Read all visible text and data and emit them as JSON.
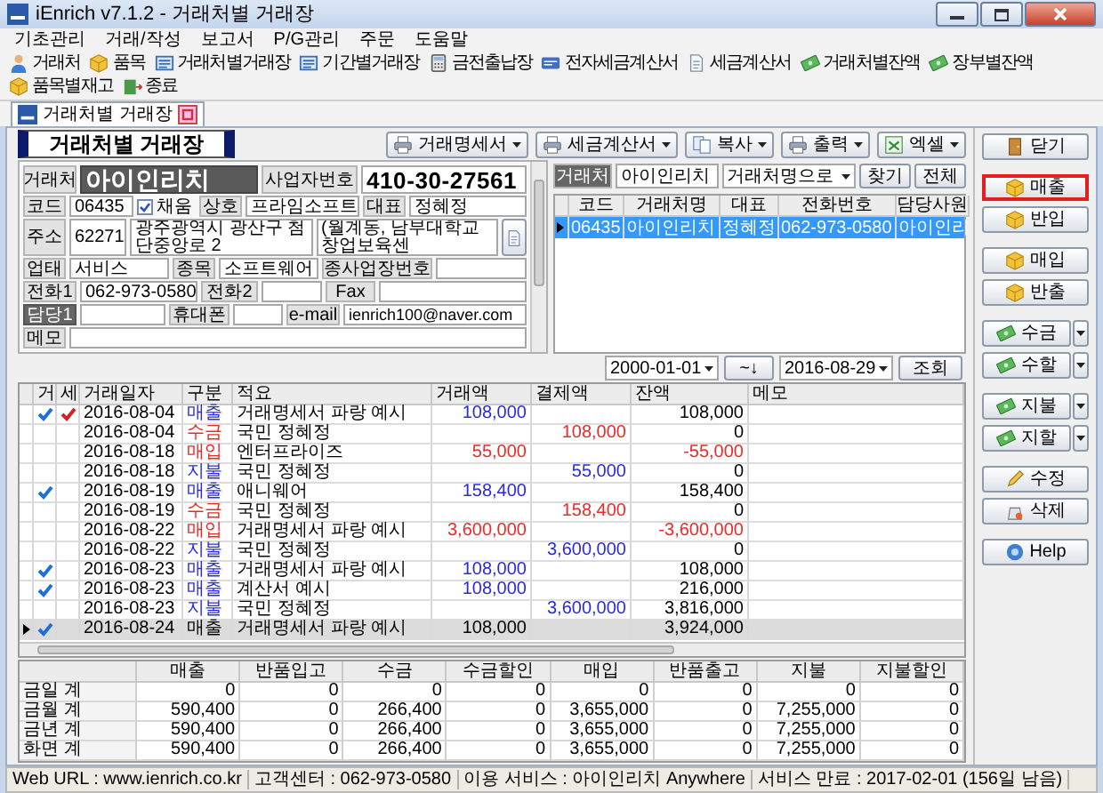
{
  "window": {
    "title": "iEnrich v7.1.2 - 거래처별 거래장"
  },
  "menu": [
    "기초관리",
    "거래/작성",
    "보고서",
    "P/G관리",
    "주문",
    "도움말"
  ],
  "toolbar": [
    "거래처",
    "품목",
    "거래처별거래장",
    "기간별거래장",
    "금전출납장",
    "전자세금계산서",
    "세금계산서",
    "거래처별잔액",
    "장부별잔액",
    "품목별재고",
    "종료"
  ],
  "tabs": [
    {
      "label": "거래처별 거래장",
      "selected": true
    }
  ],
  "page_title": "거래처별 거래장",
  "action_buttons": [
    "거래명세서",
    "세금계산서",
    "복사",
    "출력",
    "엑셀"
  ],
  "customer_form": {
    "rows": [
      [
        {
          "kind": "label",
          "text": "거래처"
        },
        {
          "kind": "name",
          "text": "아이인리치"
        },
        {
          "kind": "label",
          "text": "사업자번호"
        },
        {
          "kind": "big",
          "text": "410-30-27561"
        }
      ],
      [
        {
          "kind": "label",
          "text": "코드"
        },
        {
          "kind": "value",
          "text": "06435"
        },
        {
          "kind": "check",
          "text": "채움",
          "checked": true
        },
        {
          "kind": "label",
          "text": "상호"
        },
        {
          "kind": "value",
          "text": "프라임소프트"
        },
        {
          "kind": "label",
          "text": "대표"
        },
        {
          "kind": "value",
          "text": "정혜정"
        }
      ],
      [
        {
          "kind": "label",
          "text": "주소"
        },
        {
          "kind": "value",
          "text": "62271"
        },
        {
          "kind": "value",
          "text": "광주광역시 광산구 첨단중앙로 2"
        },
        {
          "kind": "value",
          "text": "(월계동, 남부대학교창업보육센"
        },
        {
          "kind": "lookup"
        }
      ],
      [
        {
          "kind": "label",
          "text": "업태"
        },
        {
          "kind": "value",
          "text": "서비스"
        },
        {
          "kind": "label",
          "text": "종목"
        },
        {
          "kind": "value",
          "text": "소프트웨어"
        },
        {
          "kind": "label",
          "text": "종사업장번호"
        },
        {
          "kind": "value"
        }
      ],
      [
        {
          "kind": "label",
          "text": "전화1"
        },
        {
          "kind": "value",
          "text": "062-973-0580"
        },
        {
          "kind": "label",
          "text": "전화2"
        },
        {
          "kind": "value"
        },
        {
          "kind": "label",
          "text": "Fax"
        },
        {
          "kind": "value"
        }
      ],
      [
        {
          "kind": "label_dark",
          "text": "담당1"
        },
        {
          "kind": "value"
        },
        {
          "kind": "label",
          "text": "휴대폰"
        },
        {
          "kind": "value"
        },
        {
          "kind": "label",
          "text": "e-mail"
        },
        {
          "kind": "value",
          "text": "ienrich100@naver.com"
        }
      ],
      [
        {
          "kind": "label",
          "text": "메모"
        },
        {
          "kind": "value"
        }
      ]
    ]
  },
  "customer_list": {
    "search_label": "거래처",
    "search_value": "아이인리치",
    "search_mode": "거래처명으로",
    "buttons": [
      "찾기",
      "전체"
    ],
    "columns": [
      "코드",
      "거래처명",
      "대표",
      "전화번호",
      "담당사원"
    ],
    "rows": [
      {
        "cells": [
          "06435",
          "아이인리치",
          "정혜정",
          "062-973-0580",
          "아이인리"
        ],
        "selected": true
      }
    ]
  },
  "date_filter": {
    "from": "2000-01-01",
    "range_button": "~↓",
    "to": "2016-08-29",
    "search_button": "조회"
  },
  "transactions": {
    "columns": [
      "거",
      "세",
      "거래일자",
      "구분",
      "적요",
      "거래액",
      "결제액",
      "잔액",
      "메모"
    ],
    "rows": [
      {
        "trade_checked": true,
        "tax_checked": true,
        "date": "2016-08-04",
        "kind": "sale",
        "type_label": "매출",
        "description": "거래명세서 파랑 예시",
        "amount": "108,000",
        "balance": "108,000",
        "balance_negative": false,
        "selected": false
      },
      {
        "trade_checked": false,
        "tax_checked": false,
        "date": "2016-08-04",
        "kind": "receipt",
        "type_label": "수금",
        "description": "국민 정혜정",
        "paid": "108,000",
        "balance": "0",
        "balance_negative": false,
        "selected": false
      },
      {
        "trade_checked": false,
        "tax_checked": false,
        "date": "2016-08-18",
        "kind": "purchase",
        "type_label": "매입",
        "description": "엔터프라이즈",
        "amount": "55,000",
        "balance": "-55,000",
        "balance_negative": true,
        "selected": false
      },
      {
        "trade_checked": false,
        "tax_checked": false,
        "date": "2016-08-18",
        "kind": "payment",
        "type_label": "지불",
        "description": "국민 정혜정",
        "paid": "55,000",
        "balance": "0",
        "balance_negative": false,
        "selected": false
      },
      {
        "trade_checked": true,
        "tax_checked": false,
        "date": "2016-08-19",
        "kind": "sale",
        "type_label": "매출",
        "description": "애니웨어",
        "amount": "158,400",
        "balance": "158,400",
        "balance_negative": false,
        "selected": false
      },
      {
        "trade_checked": false,
        "tax_checked": false,
        "date": "2016-08-19",
        "kind": "receipt",
        "type_label": "수금",
        "description": "국민 정혜정",
        "paid": "158,400",
        "balance": "0",
        "balance_negative": false,
        "selected": false
      },
      {
        "trade_checked": false,
        "tax_checked": false,
        "date": "2016-08-22",
        "kind": "purchase",
        "type_label": "매입",
        "description": "거래명세서 파랑 예시",
        "amount": "3,600,000",
        "balance": "-3,600,000",
        "balance_negative": true,
        "selected": false
      },
      {
        "trade_checked": false,
        "tax_checked": false,
        "date": "2016-08-22",
        "kind": "payment",
        "type_label": "지불",
        "description": "국민 정혜정",
        "paid": "3,600,000",
        "balance": "0",
        "balance_negative": false,
        "selected": false
      },
      {
        "trade_checked": true,
        "tax_checked": false,
        "date": "2016-08-23",
        "kind": "sale",
        "type_label": "매출",
        "description": "거래명세서 파랑 예시",
        "amount": "108,000",
        "balance": "108,000",
        "balance_negative": false,
        "selected": false
      },
      {
        "trade_checked": true,
        "tax_checked": false,
        "date": "2016-08-23",
        "kind": "sale",
        "type_label": "매출",
        "description": "계산서 예시",
        "amount": "108,000",
        "balance": "216,000",
        "balance_negative": false,
        "selected": false
      },
      {
        "trade_checked": false,
        "tax_checked": false,
        "date": "2016-08-23",
        "kind": "payment",
        "type_label": "지불",
        "description": "국민 정혜정",
        "paid": "3,600,000",
        "balance": "3,816,000",
        "balance_negative": false,
        "selected": false
      },
      {
        "trade_checked": true,
        "tax_checked": false,
        "date": "2016-08-24",
        "kind": "sale",
        "type_label": "매출",
        "description": "거래명세서 파랑 예시",
        "amount": "108,000",
        "balance": "3,924,000",
        "balance_negative": false,
        "selected": true
      }
    ]
  },
  "summary": {
    "columns": [
      "매출",
      "반품입고",
      "수금",
      "수금할인",
      "매입",
      "반품출고",
      "지불",
      "지불할인"
    ],
    "rows": [
      {
        "label": "금일 계",
        "values": [
          "0",
          "0",
          "0",
          "0",
          "0",
          "0",
          "0",
          "0"
        ]
      },
      {
        "label": "금월 계",
        "values": [
          "590,400",
          "0",
          "266,400",
          "0",
          "3,655,000",
          "0",
          "7,255,000",
          "0"
        ]
      },
      {
        "label": "금년 계",
        "values": [
          "590,400",
          "0",
          "266,400",
          "0",
          "3,655,000",
          "0",
          "7,255,000",
          "0"
        ]
      },
      {
        "label": "화면 계",
        "values": [
          "590,400",
          "0",
          "266,400",
          "0",
          "3,655,000",
          "0",
          "7,255,000",
          "0"
        ]
      }
    ]
  },
  "side_panel": [
    [
      {
        "label": "닫기",
        "dropdown": false,
        "highlighted": false
      }
    ],
    [
      {
        "label": "매출",
        "dropdown": false,
        "highlighted": true
      },
      {
        "label": "반입",
        "dropdown": false,
        "highlighted": false
      }
    ],
    [
      {
        "label": "매입",
        "dropdown": false,
        "highlighted": false
      },
      {
        "label": "반출",
        "dropdown": false,
        "highlighted": false
      }
    ],
    [
      {
        "label": "수금",
        "dropdown": true,
        "highlighted": false
      },
      {
        "label": "수할",
        "dropdown": true,
        "highlighted": false
      }
    ],
    [
      {
        "label": "지불",
        "dropdown": true,
        "highlighted": false
      },
      {
        "label": "지할",
        "dropdown": true,
        "highlighted": false
      }
    ],
    [
      {
        "label": "수정",
        "dropdown": false,
        "highlighted": false
      },
      {
        "label": "삭제",
        "dropdown": false,
        "highlighted": false
      }
    ],
    [
      {
        "label": "Help",
        "dropdown": false,
        "highlighted": false
      }
    ]
  ],
  "status_bar": [
    "Web URL : www.ienrich.co.kr",
    "고객센터 : 062-973-0580",
    "이용 서비스 : 아이인리치 Anywhere",
    "서비스 만료 : 2017-02-01 (156일 남음)"
  ]
}
